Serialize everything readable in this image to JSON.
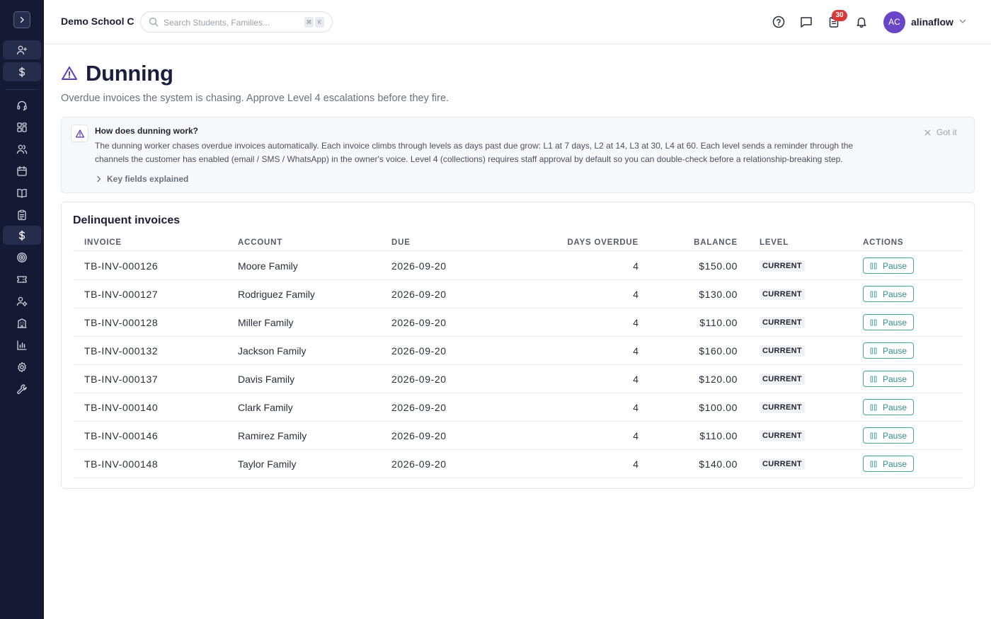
{
  "app": {
    "school_name": "Demo School C"
  },
  "search": {
    "placeholder": "Search Students, Families...",
    "kbd": [
      "⌘",
      "K"
    ]
  },
  "topbar": {
    "notification_count": "30",
    "user": {
      "initials": "AC",
      "name": "alinaflow"
    }
  },
  "sidebar": {
    "items": [
      {
        "icon": "user-plus-icon"
      },
      {
        "icon": "dollar-icon"
      },
      {
        "icon": "headset-icon"
      },
      {
        "icon": "grid-icon"
      },
      {
        "icon": "users-icon"
      },
      {
        "icon": "calendar-icon"
      },
      {
        "icon": "book-icon"
      },
      {
        "icon": "clipboard-icon"
      },
      {
        "icon": "dollar-icon"
      },
      {
        "icon": "target-icon"
      },
      {
        "icon": "ticket-icon"
      },
      {
        "icon": "user-gear-icon"
      },
      {
        "icon": "building-icon"
      },
      {
        "icon": "chart-icon"
      },
      {
        "icon": "gear-icon"
      },
      {
        "icon": "wrench-icon"
      }
    ]
  },
  "page": {
    "title": "Dunning",
    "subtitle": "Overdue invoices the system is chasing. Approve Level 4 escalations before they fire."
  },
  "info": {
    "title": "How does dunning work?",
    "body": "The dunning worker chases overdue invoices automatically. Each invoice climbs through levels as days past due grow: L1 at 7 days, L2 at 14, L3 at 30, L4 at 60. Each level sends a reminder through the channels the customer has enabled (email / SMS / WhatsApp) in the owner's voice. Level 4 (collections) requires staff approval by default so you can double-check before a relationship-breaking step.",
    "dismiss_label": "Got it",
    "key_fields_label": "Key fields explained"
  },
  "table": {
    "title": "Delinquent invoices",
    "headers": {
      "invoice": "INVOICE",
      "account": "ACCOUNT",
      "due": "DUE",
      "days_overdue": "DAYS OVERDUE",
      "balance": "BALANCE",
      "level": "LEVEL",
      "actions": "ACTIONS"
    },
    "rows": [
      {
        "invoice": "TB-INV-000126",
        "account": "Moore Family",
        "due": "2026-09-20",
        "days_overdue": "4",
        "balance": "$150.00",
        "level": "CURRENT",
        "action": "Pause"
      },
      {
        "invoice": "TB-INV-000127",
        "account": "Rodriguez Family",
        "due": "2026-09-20",
        "days_overdue": "4",
        "balance": "$130.00",
        "level": "CURRENT",
        "action": "Pause"
      },
      {
        "invoice": "TB-INV-000128",
        "account": "Miller Family",
        "due": "2026-09-20",
        "days_overdue": "4",
        "balance": "$110.00",
        "level": "CURRENT",
        "action": "Pause"
      },
      {
        "invoice": "TB-INV-000132",
        "account": "Jackson Family",
        "due": "2026-09-20",
        "days_overdue": "4",
        "balance": "$160.00",
        "level": "CURRENT",
        "action": "Pause"
      },
      {
        "invoice": "TB-INV-000137",
        "account": "Davis Family",
        "due": "2026-09-20",
        "days_overdue": "4",
        "balance": "$120.00",
        "level": "CURRENT",
        "action": "Pause"
      },
      {
        "invoice": "TB-INV-000140",
        "account": "Clark Family",
        "due": "2026-09-20",
        "days_overdue": "4",
        "balance": "$100.00",
        "level": "CURRENT",
        "action": "Pause"
      },
      {
        "invoice": "TB-INV-000146",
        "account": "Ramirez Family",
        "due": "2026-09-20",
        "days_overdue": "4",
        "balance": "$110.00",
        "level": "CURRENT",
        "action": "Pause"
      },
      {
        "invoice": "TB-INV-000148",
        "account": "Taylor Family",
        "due": "2026-09-20",
        "days_overdue": "4",
        "balance": "$140.00",
        "level": "CURRENT",
        "action": "Pause"
      }
    ]
  }
}
